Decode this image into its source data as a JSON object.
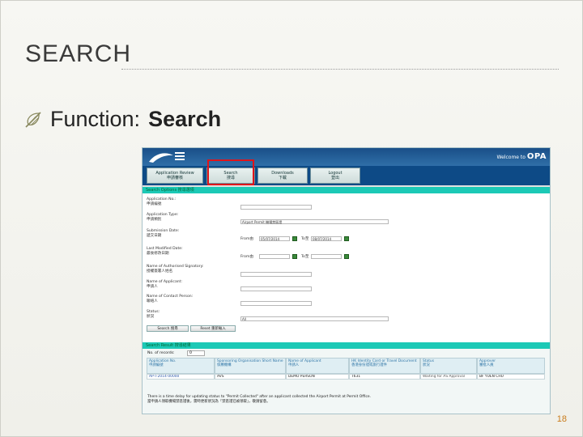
{
  "slide": {
    "title": "SEARCH",
    "bullet_label": "Function:",
    "bullet_value": "Search",
    "page_number": "18"
  },
  "app": {
    "welcome_prefix": "Welcome to",
    "welcome_brand": "OPA",
    "nav": [
      {
        "label": "Application Review",
        "sub": "申請審核"
      },
      {
        "label": "Search",
        "sub": "搜尋"
      },
      {
        "label": "Downloads",
        "sub": "下載"
      },
      {
        "label": "Logout",
        "sub": "登出"
      }
    ],
    "search_options_header": "Search Options 搜尋選項",
    "fields": {
      "app_no_label_en": "Application No.:",
      "app_no_label_zh": "申請編號",
      "app_type_label_en": "Application Type:",
      "app_type_label_zh": "申請類別",
      "app_type_value": "Airport Permit 機場禁區證",
      "submission_label_en": "Submission Date:",
      "submission_label_zh": "遞交日期",
      "from_label": "From由",
      "from_value": "05/07/2014",
      "to_label": "To至",
      "to_value": "08/07/2014",
      "last_modified_label_en": "Last Modified Date:",
      "last_modified_label_zh": "最後修改日期",
      "from2_label": "From由",
      "to2_label": "To至",
      "signatory_label_en": "Name of Authorised Signatory:",
      "signatory_label_zh": "授權簽署人姓名",
      "applicant_label_en": "Name of Applicant:",
      "applicant_label_zh": "申請人",
      "contact_label_en": "Name of Contact Person:",
      "contact_label_zh": "聯絡人",
      "status_label_en": "Status:",
      "status_label_zh": "狀況",
      "status_value": "All"
    },
    "search_button": "Search 搜尋",
    "reset_button": "Reset 重新輸入",
    "results": {
      "header": "Search Result 搜尋結果",
      "count_label": "No. of records: ",
      "count_value": "0",
      "columns": [
        {
          "en": "Application No.",
          "zh": "申請編號"
        },
        {
          "en": "Sponsoring Organisation Short Name",
          "zh": "保薦機構"
        },
        {
          "en": "Name of Applicant",
          "zh": "申請人"
        },
        {
          "en": "HK Identity Card or Travel Document",
          "zh": "香港身份證或旅行證件"
        },
        {
          "en": "Status",
          "zh": "狀況"
        },
        {
          "en": "Approver",
          "zh": "審批人員"
        }
      ],
      "rows": [
        [
          "AP-T-2014-00000",
          "AVS",
          "DEMO PERSON",
          "T631",
          "Waiting for AS Approval",
          "BF YUEN CHU"
        ]
      ],
      "note_line1": "There is a time delay for updating status to \"Permit Collected\" after an applicant collected the Airport Permit at Permit Office.",
      "note_line2": "當申請人領取機場禁區證後，需時更新狀況為「禁區證已被領取」，敬請留意。"
    }
  }
}
